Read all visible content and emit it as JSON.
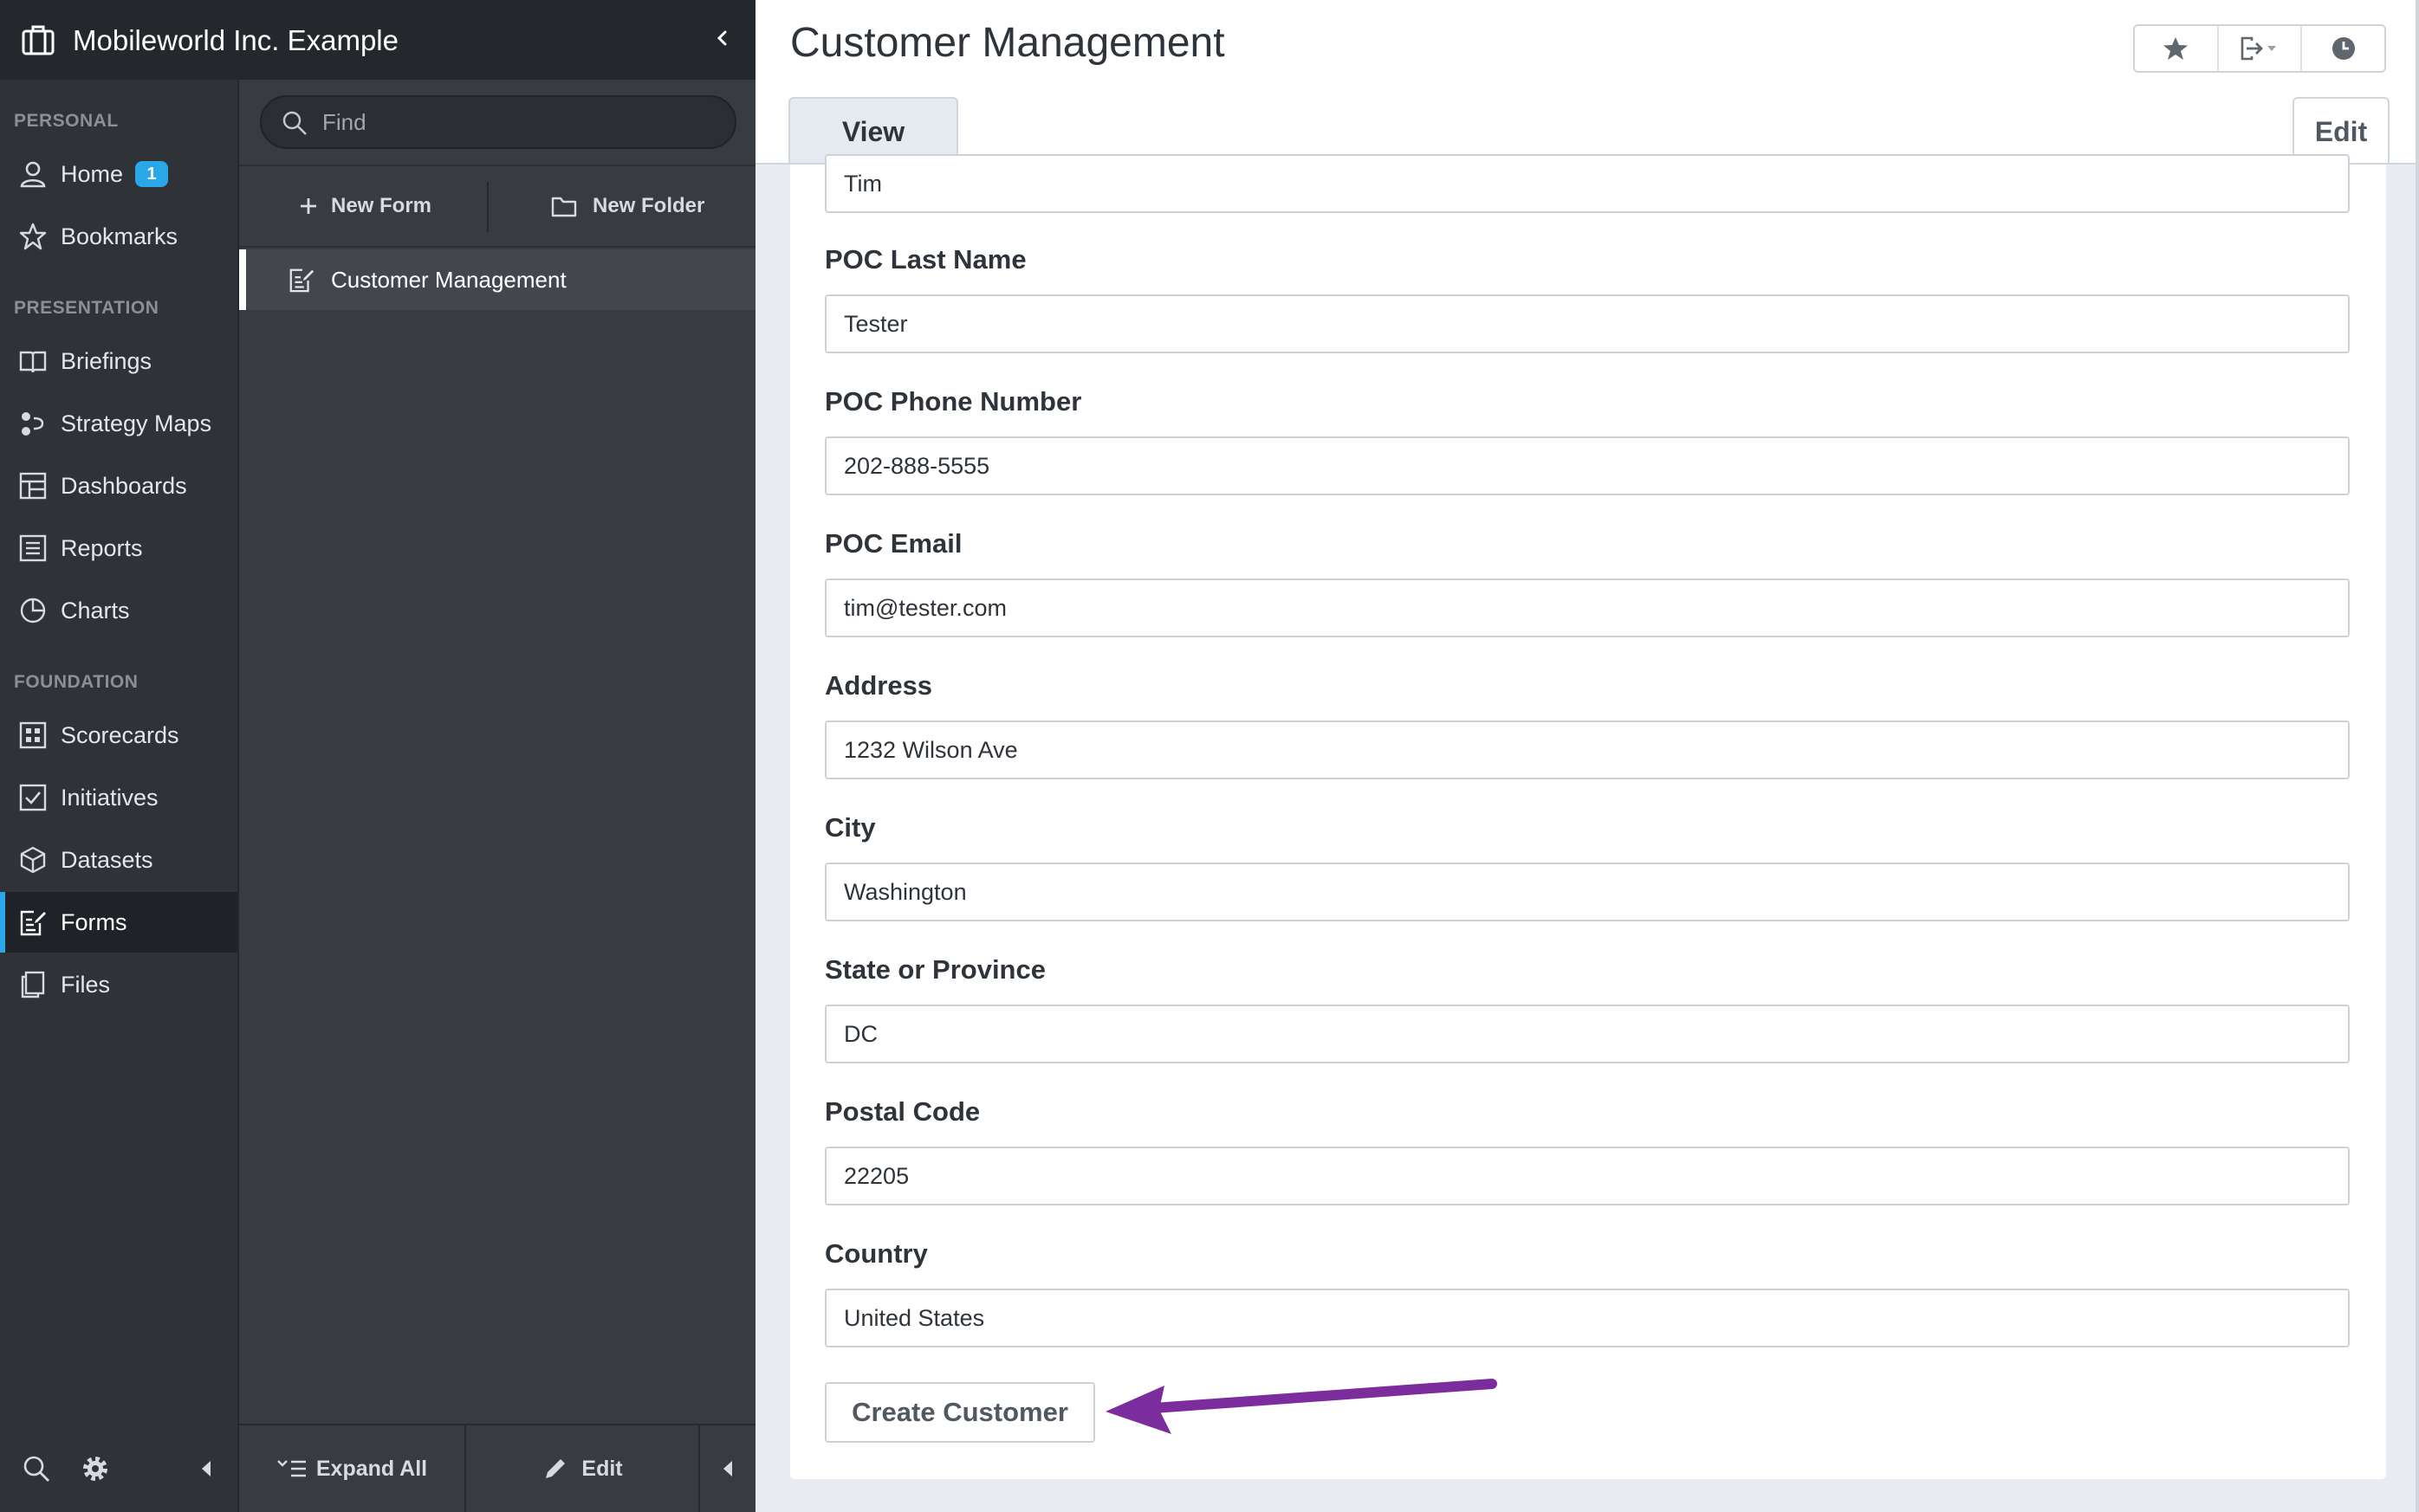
{
  "app": {
    "org_name": "Mobileworld Inc. Example"
  },
  "nav": {
    "sections": {
      "personal": "PERSONAL",
      "presentation": "PRESENTATION",
      "foundation": "FOUNDATION"
    },
    "items": {
      "home": {
        "label": "Home",
        "icon": "user-icon",
        "badge": "1"
      },
      "bookmarks": {
        "label": "Bookmarks",
        "icon": "star-icon"
      },
      "briefings": {
        "label": "Briefings",
        "icon": "book-icon"
      },
      "strategy_maps": {
        "label": "Strategy Maps",
        "icon": "strategy-map-icon"
      },
      "dashboards": {
        "label": "Dashboards",
        "icon": "dashboard-icon"
      },
      "reports": {
        "label": "Reports",
        "icon": "report-icon"
      },
      "charts": {
        "label": "Charts",
        "icon": "pie-chart-icon"
      },
      "scorecards": {
        "label": "Scorecards",
        "icon": "scorecard-icon"
      },
      "initiatives": {
        "label": "Initiatives",
        "icon": "checkbox-icon"
      },
      "datasets": {
        "label": "Datasets",
        "icon": "cube-icon"
      },
      "forms": {
        "label": "Forms",
        "icon": "form-icon",
        "active": true
      },
      "files": {
        "label": "Files",
        "icon": "files-icon"
      }
    }
  },
  "tree": {
    "find_placeholder": "Find",
    "new_form_label": "New Form",
    "new_folder_label": "New Folder",
    "selected_item": "Customer Management",
    "expand_all_label": "Expand All",
    "edit_label": "Edit"
  },
  "main": {
    "title": "Customer Management",
    "tabs": {
      "view": "View",
      "edit": "Edit"
    },
    "fields": [
      {
        "key": "poc_first_name",
        "label": "",
        "value": "Tim"
      },
      {
        "key": "poc_last_name",
        "label": "POC Last Name",
        "value": "Tester"
      },
      {
        "key": "poc_phone",
        "label": "POC Phone Number",
        "value": "202-888-5555"
      },
      {
        "key": "poc_email",
        "label": "POC Email",
        "value": "tim@tester.com"
      },
      {
        "key": "address",
        "label": "Address",
        "value": "1232 Wilson Ave"
      },
      {
        "key": "city",
        "label": "City",
        "value": "Washington"
      },
      {
        "key": "state",
        "label": "State or Province",
        "value": "DC"
      },
      {
        "key": "postal_code",
        "label": "Postal Code",
        "value": "22205"
      },
      {
        "key": "country",
        "label": "Country",
        "value": "United States"
      }
    ],
    "submit_label": "Create Customer"
  },
  "colors": {
    "accent": "#2aa7e8",
    "annotation_arrow": "#7b2d9e"
  }
}
